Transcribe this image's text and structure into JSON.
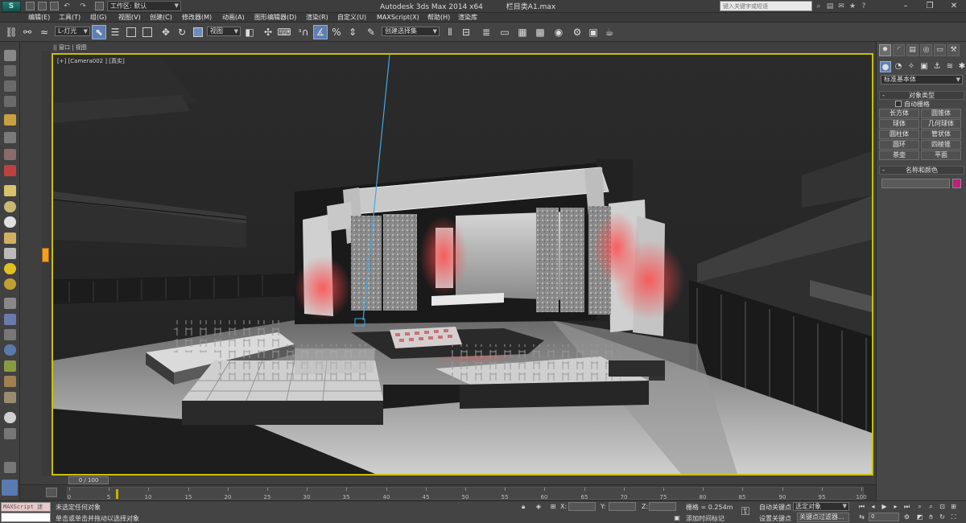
{
  "title_bar": {
    "workspace_label": "工作区: 默认",
    "app_name": "Autodesk 3ds Max  2014 x64",
    "file_name": "栏目类A1.max",
    "search_placeholder": "键入关键字或短语"
  },
  "menu": [
    "编辑(E)",
    "工具(T)",
    "组(G)",
    "视图(V)",
    "创建(C)",
    "修改器(M)",
    "动画(A)",
    "图形编辑器(D)",
    "渲染(R)",
    "自定义(U)",
    "MAXScript(X)",
    "帮助(H)",
    "渲染库"
  ],
  "toolbar": {
    "selection_filter": "L-灯光",
    "reference_coord": "视图",
    "named_selection": "创建选择集"
  },
  "viewport": {
    "label": "[+] [Camera002 ] [真实]",
    "tab_label": "|| 窗口 | 视图"
  },
  "command_panel": {
    "category": "标准基本体",
    "rollout_object_type": "对象类型",
    "autogrid": "自动栅格",
    "buttons": [
      "长方体",
      "圆锥体",
      "球体",
      "几何球体",
      "圆柱体",
      "管状体",
      "圆环",
      "四棱锥",
      "茶壶",
      "平面"
    ],
    "rollout_name_color": "名称和颜色",
    "swatch_color": "#c02080"
  },
  "time_slider": {
    "position_label": "0 / 100",
    "current_frame": 0,
    "total_frames": 100
  },
  "track_ticks": [
    "0",
    "5",
    "10",
    "15",
    "20",
    "25",
    "30",
    "35",
    "40",
    "45",
    "50",
    "55",
    "60",
    "65",
    "70",
    "75",
    "80",
    "85",
    "90",
    "95",
    "100"
  ],
  "status": {
    "maxscript_label": "MAXScript 迷",
    "selection_status": "未选定任何对象",
    "prompt": "单击或单击并拖动以选择对象",
    "x_label": "X:",
    "y_label": "Y:",
    "z_label": "Z:",
    "grid": "栅格 = 0.254m",
    "add_time_tag": "添加时间标记",
    "auto_key": "自动关键点",
    "set_key": "设置关键点",
    "selected_dropdown": "选定对象",
    "key_filters": "关键点过滤器...",
    "frame_value": "0"
  }
}
